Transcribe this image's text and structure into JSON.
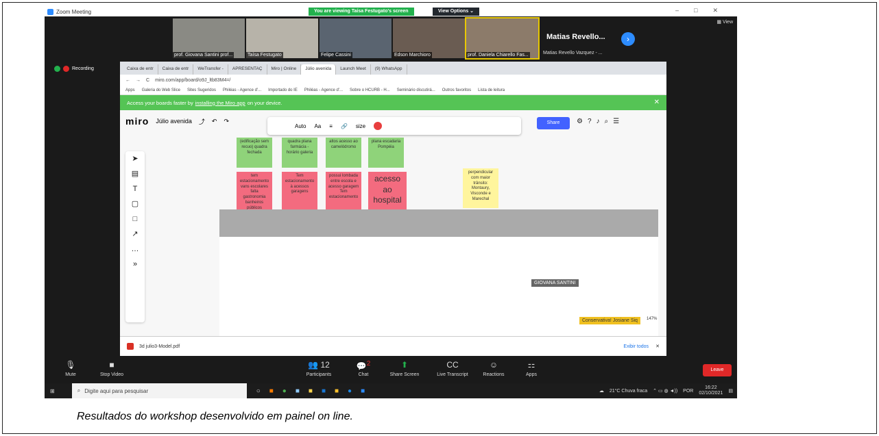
{
  "zoom": {
    "title": "Zoom Meeting",
    "viewing": "You are viewing Taísa Festugato's screen",
    "view_options": "View Options ⌄",
    "view_btn": "▦ View",
    "rec": "Recording"
  },
  "participants": [
    "prof. Giovana Santini prof...",
    "Taísa Festugato",
    "Felipe Cassini",
    "Edson Marchioro",
    "prof. Daniela Chiarello Fas...",
    "Matias Revello Vazquez - ..."
  ],
  "featured": "Matias Revello...",
  "browser": {
    "tabs": [
      "Caixa de entr",
      "Caixa de entr",
      "WeTransfer -",
      "APRESENTAÇ",
      "Miro | Online",
      "Júlio avenida",
      "Launch Meet",
      "(9) WhatsApp"
    ],
    "url": "miro.com/app/board/o9J_ltb83M4=/",
    "bookmarks": [
      "Apps",
      "Galeria do Web Slice",
      "Sites Sugeridos",
      "Philéas - Agence d'...",
      "Importado do IE",
      "Philéas - Agence d'...",
      "Sobre o HCURB - H...",
      "Seminário discutirá...",
      "Outros favoritos",
      "Lista de leitura"
    ],
    "banner": {
      "pre": "Access your boards faster by",
      "link": "installing the Miro app",
      "post": "on your device."
    }
  },
  "miro": {
    "logo": "miro",
    "board": "Júlio avenida",
    "font_size": "Auto",
    "size_label": "size",
    "share": "Share",
    "zoom": "147%"
  },
  "notes": {
    "g1": "(edificação sem recuo) quadra fechada",
    "g2": "quadra plana farmácia - horário galeria",
    "g3": "altos acesso ao camelódromo",
    "g4": "plana escadaria Pompéia",
    "p1": "tem estacionamento vans escolares falta gastronomia banheiros públicos",
    "p2": "Tem estacionamento à acessos garagens",
    "p3": "possui lombada entre escola e acesso garagem Tem estacionamento",
    "p4": "acesso ao hospital",
    "y1": "perpendicular com maior trânsito: Montaury, Visconde e Marechal"
  },
  "labels": {
    "giovana": "GIOVANA SANTINI",
    "josiane": "Conservativa! Josiane Siq"
  },
  "download": {
    "file": "3d julio3-Model.pdf",
    "show_all": "Exibir todos"
  },
  "controls": [
    "Mute",
    "Stop Video",
    "Participants",
    "Chat",
    "Share Screen",
    "Live Transcript",
    "Reactions",
    "Apps"
  ],
  "participant_count": "12",
  "chat_badge": "2",
  "leave": "Leave",
  "taskbar": {
    "search": "Digite aqui para pesquisar",
    "weather": "21°C Chuva fraca",
    "lang": "POR",
    "time": "16:22",
    "date": "02/10/2021"
  },
  "caption": "Resultados do workshop desenvolvido em painel on line."
}
